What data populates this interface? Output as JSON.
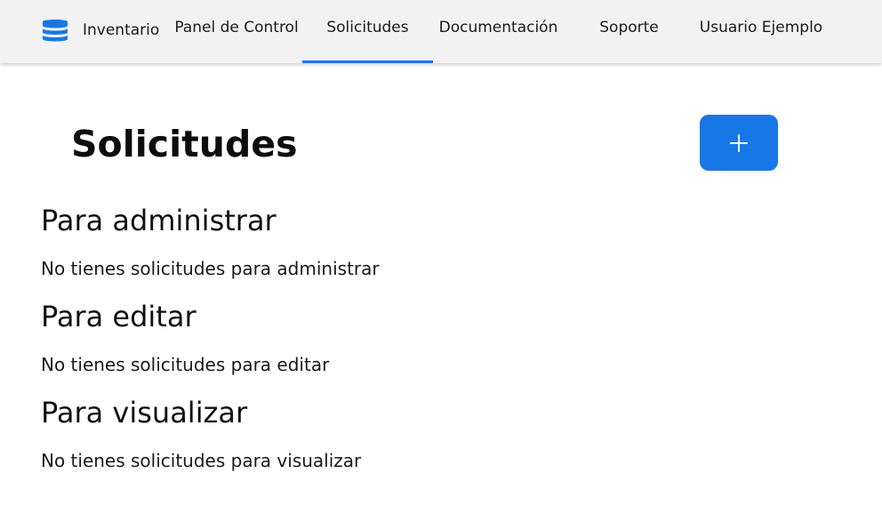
{
  "navbar": {
    "brand": {
      "label": "Inventario",
      "logo_icon": "database-icon",
      "logo_color": "#1877e6"
    },
    "items": [
      {
        "label": "Panel de Control",
        "active": false
      },
      {
        "label": "Solicitudes",
        "active": true
      },
      {
        "label": "Documentación",
        "active": false
      },
      {
        "label": "Soporte",
        "active": false
      },
      {
        "label": "Usuario Ejemplo",
        "active": false
      }
    ],
    "active_indicator_color": "#1877e6"
  },
  "page": {
    "title": "Solicitudes",
    "add_button": {
      "icon": "plus-icon",
      "color": "#1877e6"
    }
  },
  "sections": [
    {
      "heading": "Para administrar",
      "empty_message": "No tienes solicitudes para administrar"
    },
    {
      "heading": "Para editar",
      "empty_message": "No tienes solicitudes para editar"
    },
    {
      "heading": "Para visualizar",
      "empty_message": "No tienes solicitudes para visualizar"
    }
  ]
}
